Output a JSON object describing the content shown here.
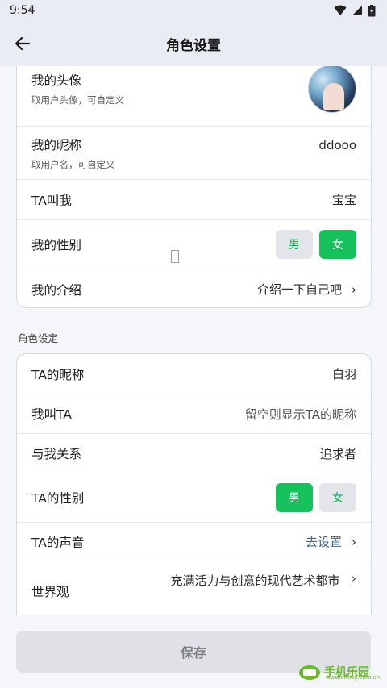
{
  "status_bar": {
    "time": "9:54"
  },
  "header": {
    "title": "角色设置"
  },
  "profile": {
    "avatar": {
      "title": "我的头像",
      "subtitle": "取用户头像，可自定义"
    },
    "nickname": {
      "title": "我的昵称",
      "subtitle": "取用户名，可自定义",
      "value": "ddooo"
    },
    "ta_calls_me": {
      "title": "TA叫我",
      "value": "宝宝"
    },
    "gender": {
      "title": "我的性别",
      "options": [
        "男",
        "女"
      ],
      "selected": "女"
    },
    "intro": {
      "title": "我的介绍",
      "value": "介绍一下自己吧"
    }
  },
  "role_section": {
    "label": "角色设定",
    "ta_nickname": {
      "title": "TA的昵称",
      "value": "白羽"
    },
    "i_call_ta": {
      "title": "我叫TA",
      "placeholder": "留空则显示TA的昵称"
    },
    "relation": {
      "title": "与我关系",
      "value": "追求者"
    },
    "ta_gender": {
      "title": "TA的性别",
      "options": [
        "男",
        "女"
      ],
      "selected": "男"
    },
    "ta_voice": {
      "title": "TA的声音",
      "value": "去设置"
    },
    "worldview": {
      "title": "世界观",
      "value": "充满活力与创意的现代艺术都市"
    }
  },
  "footer": {
    "save_label": "保存"
  },
  "watermark": {
    "text": "手机乐园",
    "sub": "www.shouji.com.cn"
  },
  "colors": {
    "accent": "#17c25c",
    "link": "#3e6a96",
    "background": "#f5f6fa"
  }
}
